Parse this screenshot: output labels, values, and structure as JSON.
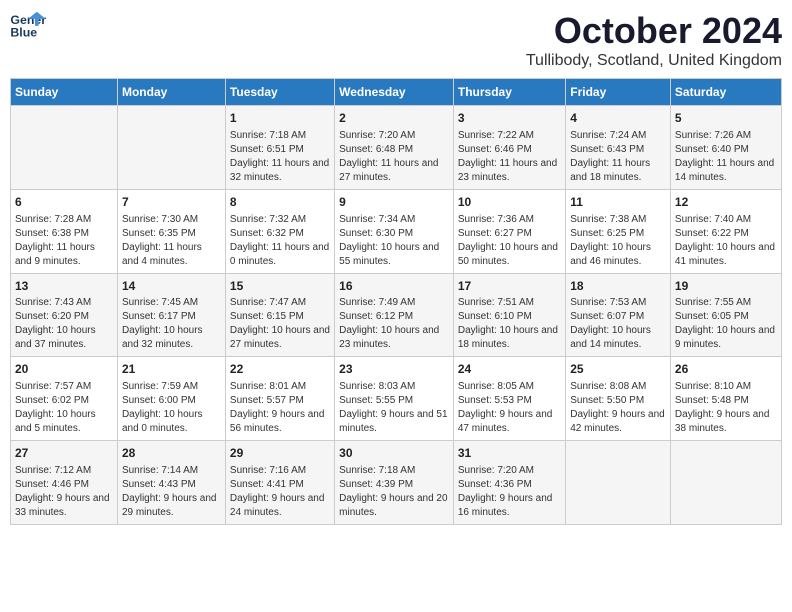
{
  "logo": {
    "line1": "General",
    "line2": "Blue"
  },
  "title": "October 2024",
  "location": "Tullibody, Scotland, United Kingdom",
  "headers": [
    "Sunday",
    "Monday",
    "Tuesday",
    "Wednesday",
    "Thursday",
    "Friday",
    "Saturday"
  ],
  "weeks": [
    [
      {
        "day": "",
        "sunrise": "",
        "sunset": "",
        "daylight": ""
      },
      {
        "day": "",
        "sunrise": "",
        "sunset": "",
        "daylight": ""
      },
      {
        "day": "1",
        "sunrise": "Sunrise: 7:18 AM",
        "sunset": "Sunset: 6:51 PM",
        "daylight": "Daylight: 11 hours and 32 minutes."
      },
      {
        "day": "2",
        "sunrise": "Sunrise: 7:20 AM",
        "sunset": "Sunset: 6:48 PM",
        "daylight": "Daylight: 11 hours and 27 minutes."
      },
      {
        "day": "3",
        "sunrise": "Sunrise: 7:22 AM",
        "sunset": "Sunset: 6:46 PM",
        "daylight": "Daylight: 11 hours and 23 minutes."
      },
      {
        "day": "4",
        "sunrise": "Sunrise: 7:24 AM",
        "sunset": "Sunset: 6:43 PM",
        "daylight": "Daylight: 11 hours and 18 minutes."
      },
      {
        "day": "5",
        "sunrise": "Sunrise: 7:26 AM",
        "sunset": "Sunset: 6:40 PM",
        "daylight": "Daylight: 11 hours and 14 minutes."
      }
    ],
    [
      {
        "day": "6",
        "sunrise": "Sunrise: 7:28 AM",
        "sunset": "Sunset: 6:38 PM",
        "daylight": "Daylight: 11 hours and 9 minutes."
      },
      {
        "day": "7",
        "sunrise": "Sunrise: 7:30 AM",
        "sunset": "Sunset: 6:35 PM",
        "daylight": "Daylight: 11 hours and 4 minutes."
      },
      {
        "day": "8",
        "sunrise": "Sunrise: 7:32 AM",
        "sunset": "Sunset: 6:32 PM",
        "daylight": "Daylight: 11 hours and 0 minutes."
      },
      {
        "day": "9",
        "sunrise": "Sunrise: 7:34 AM",
        "sunset": "Sunset: 6:30 PM",
        "daylight": "Daylight: 10 hours and 55 minutes."
      },
      {
        "day": "10",
        "sunrise": "Sunrise: 7:36 AM",
        "sunset": "Sunset: 6:27 PM",
        "daylight": "Daylight: 10 hours and 50 minutes."
      },
      {
        "day": "11",
        "sunrise": "Sunrise: 7:38 AM",
        "sunset": "Sunset: 6:25 PM",
        "daylight": "Daylight: 10 hours and 46 minutes."
      },
      {
        "day": "12",
        "sunrise": "Sunrise: 7:40 AM",
        "sunset": "Sunset: 6:22 PM",
        "daylight": "Daylight: 10 hours and 41 minutes."
      }
    ],
    [
      {
        "day": "13",
        "sunrise": "Sunrise: 7:43 AM",
        "sunset": "Sunset: 6:20 PM",
        "daylight": "Daylight: 10 hours and 37 minutes."
      },
      {
        "day": "14",
        "sunrise": "Sunrise: 7:45 AM",
        "sunset": "Sunset: 6:17 PM",
        "daylight": "Daylight: 10 hours and 32 minutes."
      },
      {
        "day": "15",
        "sunrise": "Sunrise: 7:47 AM",
        "sunset": "Sunset: 6:15 PM",
        "daylight": "Daylight: 10 hours and 27 minutes."
      },
      {
        "day": "16",
        "sunrise": "Sunrise: 7:49 AM",
        "sunset": "Sunset: 6:12 PM",
        "daylight": "Daylight: 10 hours and 23 minutes."
      },
      {
        "day": "17",
        "sunrise": "Sunrise: 7:51 AM",
        "sunset": "Sunset: 6:10 PM",
        "daylight": "Daylight: 10 hours and 18 minutes."
      },
      {
        "day": "18",
        "sunrise": "Sunrise: 7:53 AM",
        "sunset": "Sunset: 6:07 PM",
        "daylight": "Daylight: 10 hours and 14 minutes."
      },
      {
        "day": "19",
        "sunrise": "Sunrise: 7:55 AM",
        "sunset": "Sunset: 6:05 PM",
        "daylight": "Daylight: 10 hours and 9 minutes."
      }
    ],
    [
      {
        "day": "20",
        "sunrise": "Sunrise: 7:57 AM",
        "sunset": "Sunset: 6:02 PM",
        "daylight": "Daylight: 10 hours and 5 minutes."
      },
      {
        "day": "21",
        "sunrise": "Sunrise: 7:59 AM",
        "sunset": "Sunset: 6:00 PM",
        "daylight": "Daylight: 10 hours and 0 minutes."
      },
      {
        "day": "22",
        "sunrise": "Sunrise: 8:01 AM",
        "sunset": "Sunset: 5:57 PM",
        "daylight": "Daylight: 9 hours and 56 minutes."
      },
      {
        "day": "23",
        "sunrise": "Sunrise: 8:03 AM",
        "sunset": "Sunset: 5:55 PM",
        "daylight": "Daylight: 9 hours and 51 minutes."
      },
      {
        "day": "24",
        "sunrise": "Sunrise: 8:05 AM",
        "sunset": "Sunset: 5:53 PM",
        "daylight": "Daylight: 9 hours and 47 minutes."
      },
      {
        "day": "25",
        "sunrise": "Sunrise: 8:08 AM",
        "sunset": "Sunset: 5:50 PM",
        "daylight": "Daylight: 9 hours and 42 minutes."
      },
      {
        "day": "26",
        "sunrise": "Sunrise: 8:10 AM",
        "sunset": "Sunset: 5:48 PM",
        "daylight": "Daylight: 9 hours and 38 minutes."
      }
    ],
    [
      {
        "day": "27",
        "sunrise": "Sunrise: 7:12 AM",
        "sunset": "Sunset: 4:46 PM",
        "daylight": "Daylight: 9 hours and 33 minutes."
      },
      {
        "day": "28",
        "sunrise": "Sunrise: 7:14 AM",
        "sunset": "Sunset: 4:43 PM",
        "daylight": "Daylight: 9 hours and 29 minutes."
      },
      {
        "day": "29",
        "sunrise": "Sunrise: 7:16 AM",
        "sunset": "Sunset: 4:41 PM",
        "daylight": "Daylight: 9 hours and 24 minutes."
      },
      {
        "day": "30",
        "sunrise": "Sunrise: 7:18 AM",
        "sunset": "Sunset: 4:39 PM",
        "daylight": "Daylight: 9 hours and 20 minutes."
      },
      {
        "day": "31",
        "sunrise": "Sunrise: 7:20 AM",
        "sunset": "Sunset: 4:36 PM",
        "daylight": "Daylight: 9 hours and 16 minutes."
      },
      {
        "day": "",
        "sunrise": "",
        "sunset": "",
        "daylight": ""
      },
      {
        "day": "",
        "sunrise": "",
        "sunset": "",
        "daylight": ""
      }
    ]
  ]
}
